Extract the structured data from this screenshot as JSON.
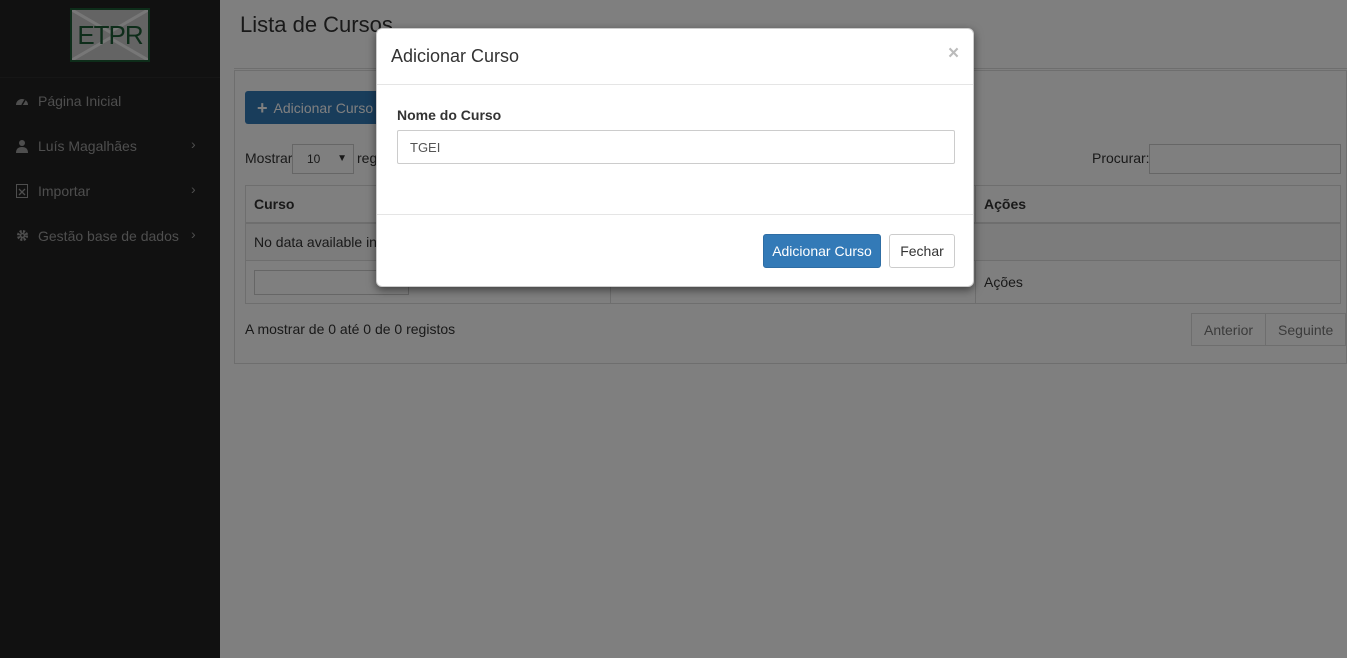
{
  "logo": {
    "text": "ETPR"
  },
  "sidebar": {
    "items": [
      {
        "label": "Página Inicial",
        "icon": "dashboard-icon",
        "has_submenu": false
      },
      {
        "label": "Luís Magalhães",
        "icon": "user-icon",
        "has_submenu": true
      },
      {
        "label": "Importar",
        "icon": "file-excel-icon",
        "has_submenu": true
      },
      {
        "label": "Gestão base de dados",
        "icon": "gear-icon",
        "has_submenu": true
      }
    ],
    "chevron": "›"
  },
  "main": {
    "title": "Lista de Cursos",
    "add_button": "Adicionar Curso",
    "show_label": "Mostrar",
    "page_length": "10",
    "records_label": "registos",
    "search_label": "Procurar:",
    "search_value": "",
    "table": {
      "headers": [
        "Curso",
        "",
        "Ações"
      ],
      "empty_message": "No data available in table",
      "footer_last": "Ações"
    },
    "info": "A mostrar de 0 até 0 de 0 registos",
    "pager": {
      "prev": "Anterior",
      "next": "Seguinte"
    }
  },
  "modal": {
    "title": "Adicionar Curso",
    "close": "×",
    "field_label": "Nome do Curso",
    "field_value": "TGEI",
    "submit": "Adicionar Curso",
    "cancel": "Fechar"
  },
  "colors": {
    "primary": "#337ab7",
    "sidebar_bg": "#222222",
    "logo_green": "#1d5a35"
  }
}
